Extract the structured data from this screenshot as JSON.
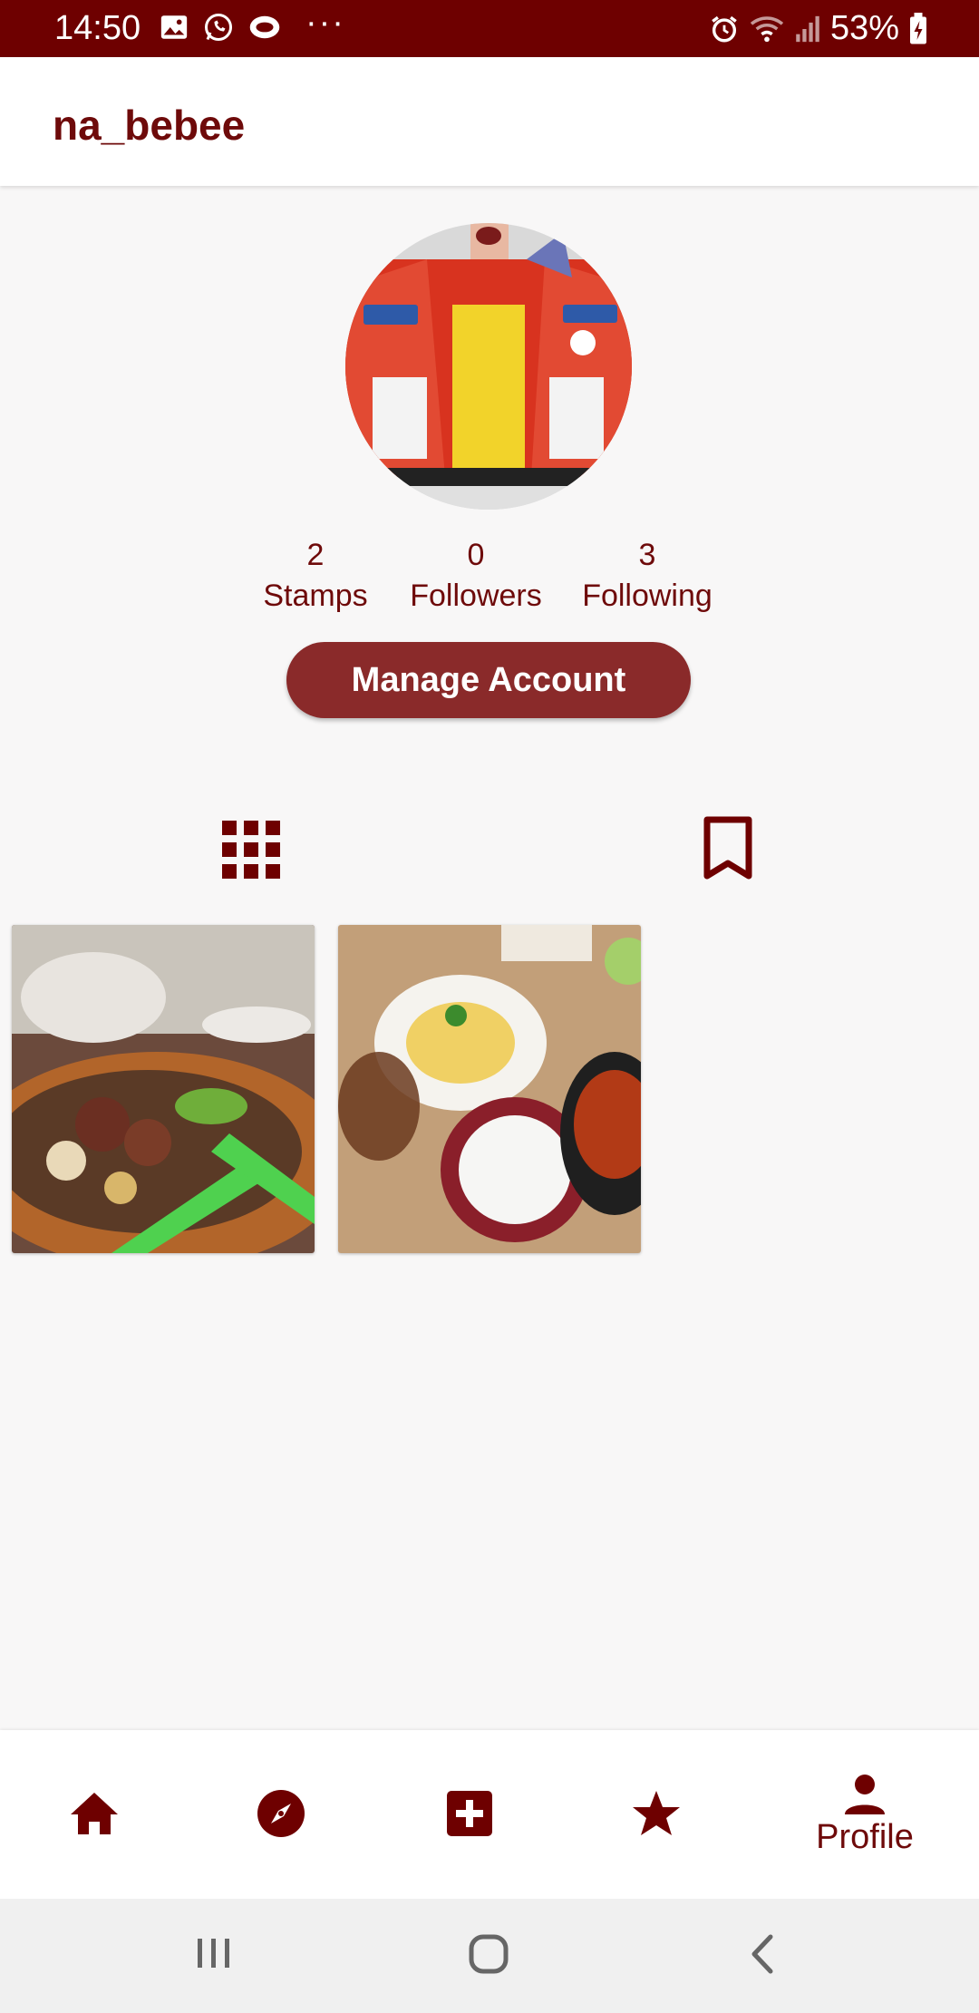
{
  "status_bar": {
    "time": "14:50",
    "battery": "53%",
    "icons_left": [
      "gallery-icon",
      "whatsapp-icon",
      "app-notification-icon",
      "more-dots-icon"
    ],
    "icons_right": [
      "alarm-icon",
      "wifi-icon",
      "signal-icon",
      "battery-icon"
    ]
  },
  "appbar": {
    "title": "na_bebee"
  },
  "profile": {
    "stats": [
      {
        "value": "2",
        "label": "Stamps"
      },
      {
        "value": "0",
        "label": "Followers"
      },
      {
        "value": "3",
        "label": "Following"
      }
    ],
    "manage_label": "Manage Account"
  },
  "tabs": [
    "grid-icon",
    "bookmark-icon"
  ],
  "posts": [
    "food-photo-1",
    "food-photo-2"
  ],
  "bottom_nav": {
    "items": [
      {
        "icon": "home-icon",
        "label": ""
      },
      {
        "icon": "explore-icon",
        "label": ""
      },
      {
        "icon": "add-icon",
        "label": ""
      },
      {
        "icon": "star-icon",
        "label": ""
      },
      {
        "icon": "profile-icon",
        "label": "Profile"
      }
    ]
  },
  "colors": {
    "primary": "#6e0000",
    "accent_button": "#8a2a2a",
    "background": "#f8f7f7"
  }
}
